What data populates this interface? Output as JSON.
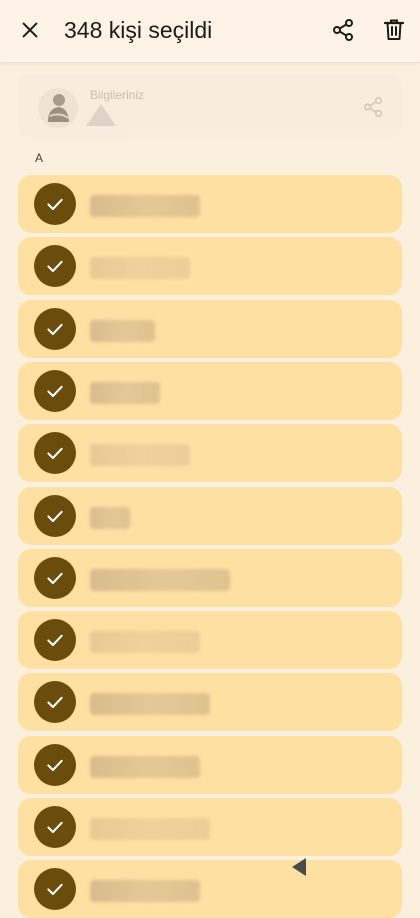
{
  "header": {
    "title": "348 kişi seçildi",
    "close_icon": "close-icon",
    "share_icon": "share-icon",
    "delete_icon": "delete-icon"
  },
  "profile": {
    "label": "Bilgileriniz",
    "share_icon": "share-icon"
  },
  "section": {
    "letter": "A"
  },
  "contacts": [
    {
      "selected": true
    },
    {
      "selected": true
    },
    {
      "selected": true
    },
    {
      "selected": true
    },
    {
      "selected": true
    },
    {
      "selected": true
    },
    {
      "selected": true
    },
    {
      "selected": true
    },
    {
      "selected": true
    },
    {
      "selected": true
    },
    {
      "selected": true
    },
    {
      "selected": true
    }
  ],
  "colors": {
    "row_bg": "#ffe0a3",
    "check_bg": "#6a4d0c",
    "page_bg": "#fbefde"
  }
}
